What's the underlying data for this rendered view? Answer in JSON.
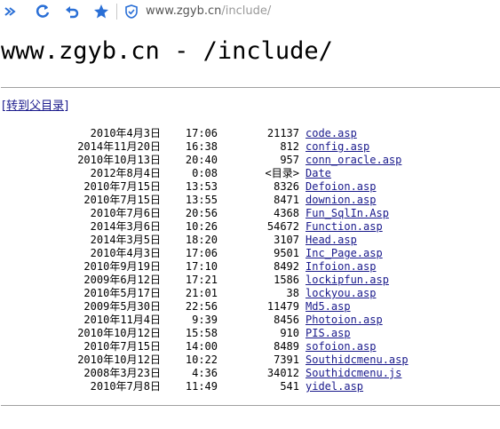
{
  "browser": {
    "url_host": "www.zgyb.cn",
    "url_path": "/include/"
  },
  "page": {
    "title": "www.zgyb.cn - /include/",
    "parent_link": "[转到父目录]"
  },
  "listing": [
    {
      "date": "2010年4月3日",
      "time": "17:06",
      "size": "21137",
      "name": "code.asp"
    },
    {
      "date": "2014年11月20日",
      "time": "16:38",
      "size": "812",
      "name": "config.asp"
    },
    {
      "date": "2010年10月13日",
      "time": "20:40",
      "size": "957",
      "name": "conn_oracle.asp"
    },
    {
      "date": "2012年8月4日",
      "time": "0:08",
      "size": "<目录>",
      "name": "Date"
    },
    {
      "date": "2010年7月15日",
      "time": "13:53",
      "size": "8326",
      "name": "Defoion.asp"
    },
    {
      "date": "2010年7月15日",
      "time": "13:55",
      "size": "8471",
      "name": "downion.asp"
    },
    {
      "date": "2010年7月6日",
      "time": "20:56",
      "size": "4368",
      "name": "Fun_SqlIn.Asp"
    },
    {
      "date": "2014年3月6日",
      "time": "10:26",
      "size": "54672",
      "name": "Function.asp"
    },
    {
      "date": "2014年3月5日",
      "time": "18:20",
      "size": "3107",
      "name": "Head.asp"
    },
    {
      "date": "2010年4月3日",
      "time": "17:06",
      "size": "9501",
      "name": "Inc_Page.asp"
    },
    {
      "date": "2010年9月19日",
      "time": "17:10",
      "size": "8492",
      "name": "Infoion.asp"
    },
    {
      "date": "2009年6月12日",
      "time": "17:21",
      "size": "1586",
      "name": "lockipfun.asp"
    },
    {
      "date": "2010年5月17日",
      "time": "21:01",
      "size": "38",
      "name": "lockyou.asp"
    },
    {
      "date": "2009年5月30日",
      "time": "22:56",
      "size": "11479",
      "name": "Md5.asp"
    },
    {
      "date": "2010年11月4日",
      "time": "9:39",
      "size": "8456",
      "name": "Photoion.asp"
    },
    {
      "date": "2010年10月12日",
      "time": "15:58",
      "size": "910",
      "name": "PIS.asp"
    },
    {
      "date": "2010年7月15日",
      "time": "14:00",
      "size": "8489",
      "name": "sofoion.asp"
    },
    {
      "date": "2010年10月12日",
      "time": "10:22",
      "size": "7391",
      "name": "Southidcmenu.asp"
    },
    {
      "date": "2008年3月23日",
      "time": "4:36",
      "size": "34012",
      "name": "Southidcmenu.js"
    },
    {
      "date": "2010年7月8日",
      "time": "11:49",
      "size": "541",
      "name": "yidel.asp"
    }
  ],
  "colors": {
    "link": "#1a1a8c",
    "rule": "#a0a0a0",
    "toolbar_icon": "#2a6fd6"
  },
  "icons": [
    "collapse-icon",
    "refresh-icon",
    "undo-icon",
    "favorite-star-icon",
    "security-shield-icon"
  ]
}
